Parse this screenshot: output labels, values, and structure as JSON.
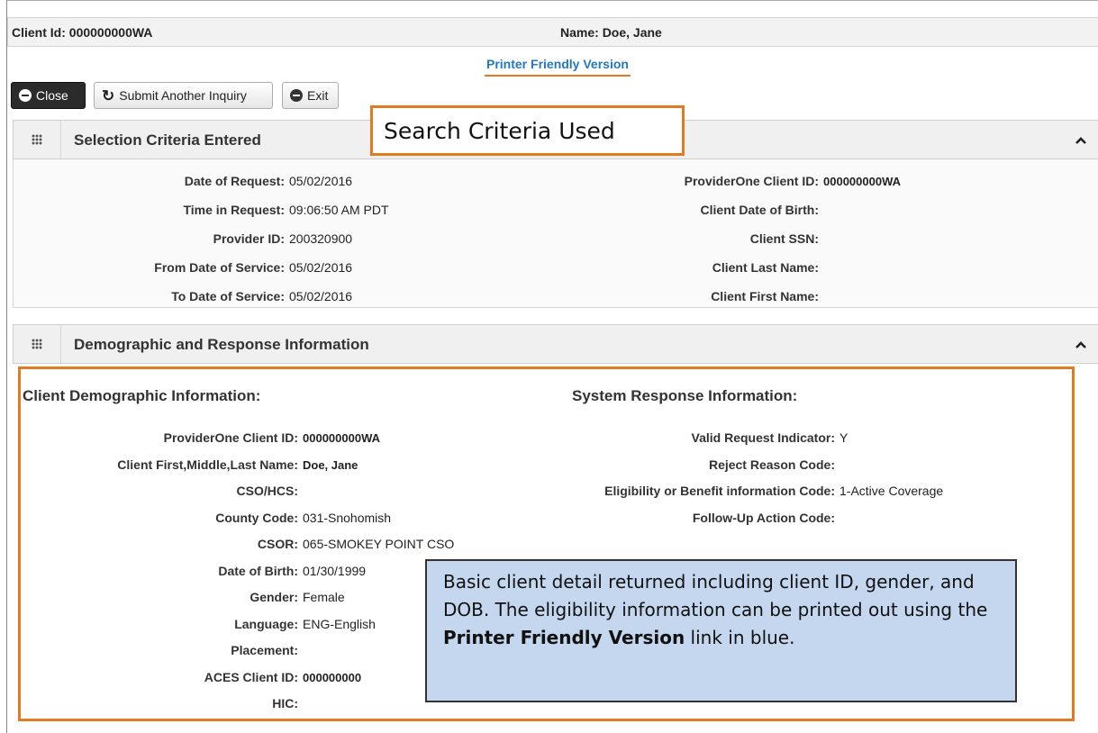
{
  "client": {
    "id_label": "Client Id:",
    "id_value": "000000000WA",
    "name_label": "Name:",
    "name_value": "Doe, Jane"
  },
  "printer_link": "Printer Friendly Version",
  "toolbar": {
    "close_label": "Close",
    "submit_label": "Submit Another Inquiry",
    "exit_label": "Exit"
  },
  "callout_search": "Search Criteria Used",
  "selection": {
    "title": "Selection Criteria Entered",
    "left": [
      {
        "label": "Date of Request:",
        "value": "05/02/2016"
      },
      {
        "label": "Time in Request:",
        "value": "09:06:50 AM PDT"
      },
      {
        "label": "Provider ID:",
        "value": "200320900"
      },
      {
        "label": "From Date of Service:",
        "value": "05/02/2016"
      },
      {
        "label": "To Date of Service:",
        "value": "05/02/2016"
      }
    ],
    "right": [
      {
        "label": "ProviderOne Client ID:",
        "value": "000000000WA"
      },
      {
        "label": "Client Date of Birth:",
        "value": ""
      },
      {
        "label": "Client SSN:",
        "value": ""
      },
      {
        "label": "Client Last Name:",
        "value": ""
      },
      {
        "label": "Client First Name:",
        "value": ""
      }
    ]
  },
  "demographic": {
    "title": "Demographic and Response Information",
    "client_heading": "Client Demographic Information:",
    "system_heading": "System Response Information:",
    "left": [
      {
        "label": "ProviderOne Client ID:",
        "value": "000000000WA"
      },
      {
        "label": "Client First,Middle,Last Name:",
        "value": "Doe, Jane"
      },
      {
        "label": "CSO/HCS:",
        "value": ""
      },
      {
        "label": "County Code:",
        "value": "031-Snohomish"
      },
      {
        "label": "CSOR:",
        "value": "065-SMOKEY POINT CSO"
      },
      {
        "label": "Date of Birth:",
        "value": "01/30/1999"
      },
      {
        "label": "Gender:",
        "value": "Female"
      },
      {
        "label": "Language:",
        "value": "ENG-English"
      },
      {
        "label": "Placement:",
        "value": ""
      },
      {
        "label": "ACES Client ID:",
        "value": "000000000"
      },
      {
        "label": "HIC:",
        "value": ""
      }
    ],
    "right": [
      {
        "label": "Valid Request Indicator:",
        "value": "Y"
      },
      {
        "label": "Reject Reason Code:",
        "value": ""
      },
      {
        "label": "Eligibility or Benefit information Code:",
        "value": "1-Active Coverage"
      },
      {
        "label": "Follow-Up Action Code:",
        "value": ""
      }
    ]
  },
  "info_callout": {
    "text_before": "Basic client detail returned including client ID, gender, and DOB. The eligibility information can be printed out using the ",
    "bold": "Printer Friendly Version",
    "text_after": " link in blue."
  },
  "colors": {
    "accent_orange": "#e07b22",
    "link_blue": "#2677bb",
    "callout_blue": "#c5d7ee"
  }
}
